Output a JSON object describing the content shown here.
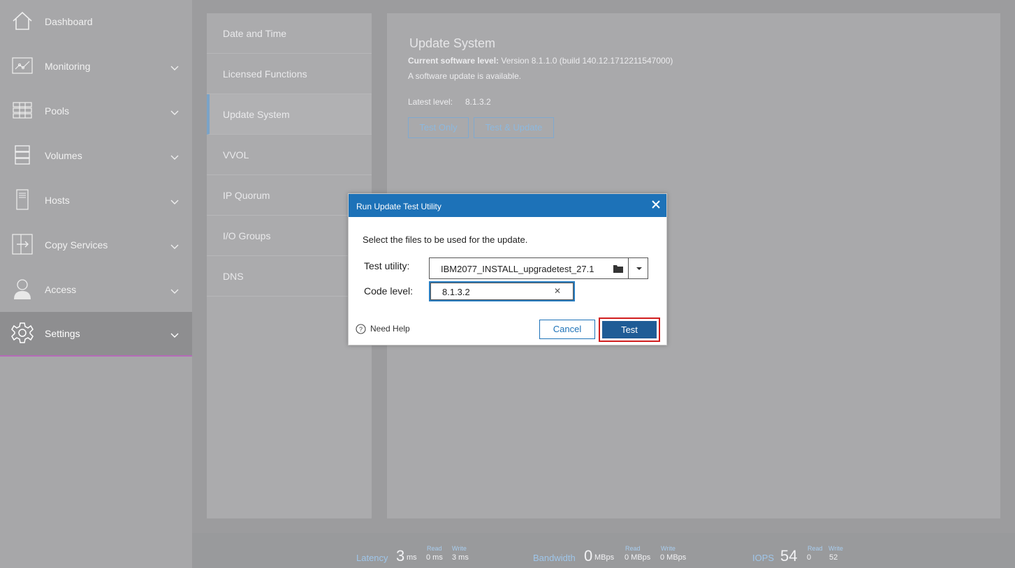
{
  "sidebar": {
    "items": [
      {
        "label": "Dashboard",
        "icon": "home-icon"
      },
      {
        "label": "Monitoring",
        "icon": "monitoring-icon"
      },
      {
        "label": "Pools",
        "icon": "pools-icon"
      },
      {
        "label": "Volumes",
        "icon": "volumes-icon"
      },
      {
        "label": "Hosts",
        "icon": "hosts-icon"
      },
      {
        "label": "Copy Services",
        "icon": "copy-services-icon"
      },
      {
        "label": "Access",
        "icon": "access-icon"
      },
      {
        "label": "Settings",
        "icon": "settings-gear-icon"
      }
    ],
    "active": "Settings"
  },
  "subnav": {
    "items": [
      {
        "label": "Date and Time"
      },
      {
        "label": "Licensed Functions"
      },
      {
        "label": "Update System"
      },
      {
        "label": "VVOL"
      },
      {
        "label": "IP Quorum"
      },
      {
        "label": "I/O Groups"
      },
      {
        "label": "DNS"
      }
    ],
    "active": "Update System"
  },
  "panel": {
    "title": "Update System",
    "current_level_label": "Current software level:",
    "current_level_value": " Version 8.1.1.0 (build 140.12.1712211547000)",
    "update_available": "A software update is available.",
    "latest_label": "Latest level:",
    "latest_value": "8.1.3.2",
    "test_only_label": "Test Only",
    "test_update_label": "Test & Update"
  },
  "modal": {
    "title": "Run Update Test Utility",
    "instructions": "Select the files to be used for the update.",
    "test_utility_label": "Test utility:",
    "test_utility_value": "IBM2077_INSTALL_upgradetest_27.1",
    "code_level_label": "Code level:",
    "code_level_value": "8.1.3.2",
    "help_label": "Need Help",
    "cancel_label": "Cancel",
    "test_label": "Test",
    "header_color": "#1d72b8",
    "highlight_color": "#d11d1d"
  },
  "footer": {
    "latency": {
      "label": "Latency",
      "value": "3",
      "unit": "ms",
      "read_label": "Read",
      "read_value": "0 ms",
      "write_label": "Write",
      "write_value": "3 ms"
    },
    "bandwidth": {
      "label": "Bandwidth",
      "value": "0",
      "unit": "MBps",
      "read_label": "Read",
      "read_value": "0 MBps",
      "write_label": "Write",
      "write_value": "0 MBps"
    },
    "iops": {
      "label": "IOPS",
      "value": "54",
      "read_label": "Read",
      "read_value": "0",
      "write_label": "Write",
      "write_value": "52"
    }
  }
}
